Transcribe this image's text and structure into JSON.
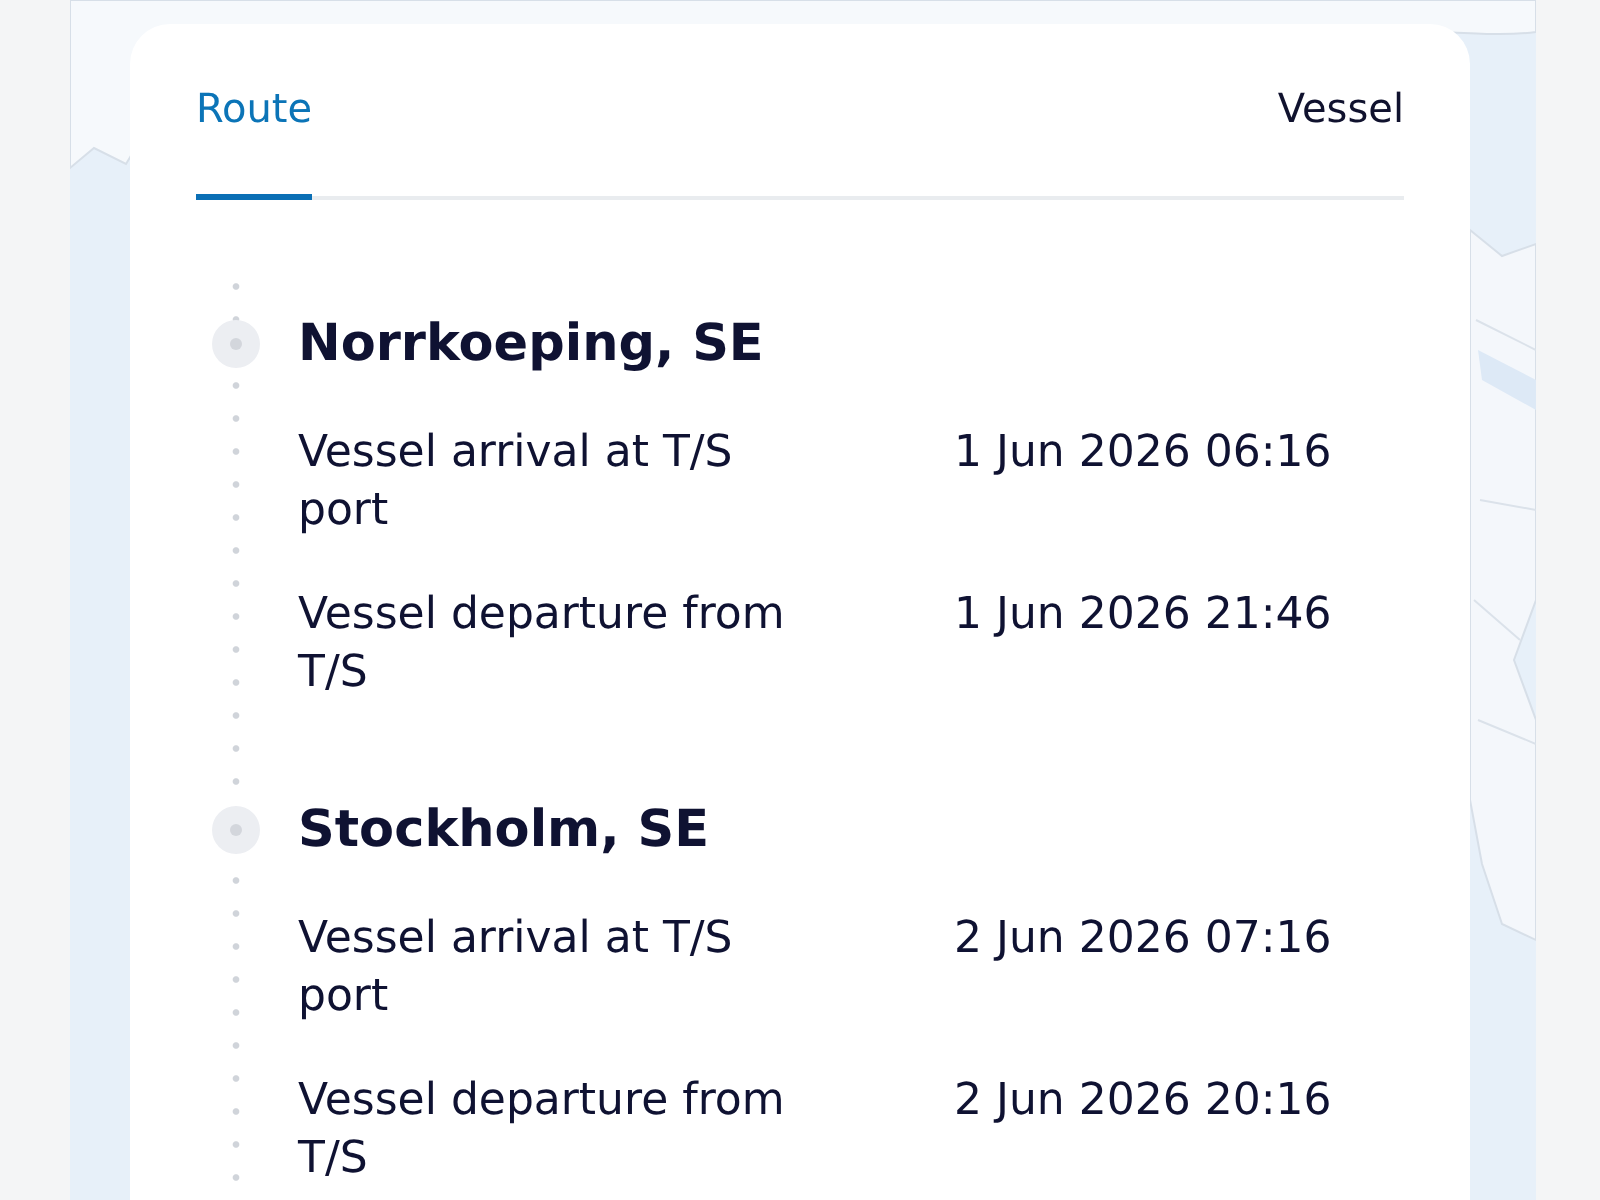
{
  "tabs": [
    {
      "label": "Route",
      "selected": true
    },
    {
      "label": "Vessel",
      "selected": false
    }
  ],
  "stops": [
    {
      "name": "Norrkoeping, SE",
      "events": [
        {
          "label": "Vessel arrival at T/S port",
          "time": "1 Jun 2026 06:16"
        },
        {
          "label": "Vessel departure from T/S",
          "time": "1 Jun 2026 21:46"
        }
      ]
    },
    {
      "name": "Stockholm, SE",
      "events": [
        {
          "label": "Vessel arrival at T/S port",
          "time": "2 Jun 2026 07:16"
        },
        {
          "label": "Vessel departure from T/S",
          "time": "2 Jun 2026 20:16"
        }
      ]
    }
  ]
}
